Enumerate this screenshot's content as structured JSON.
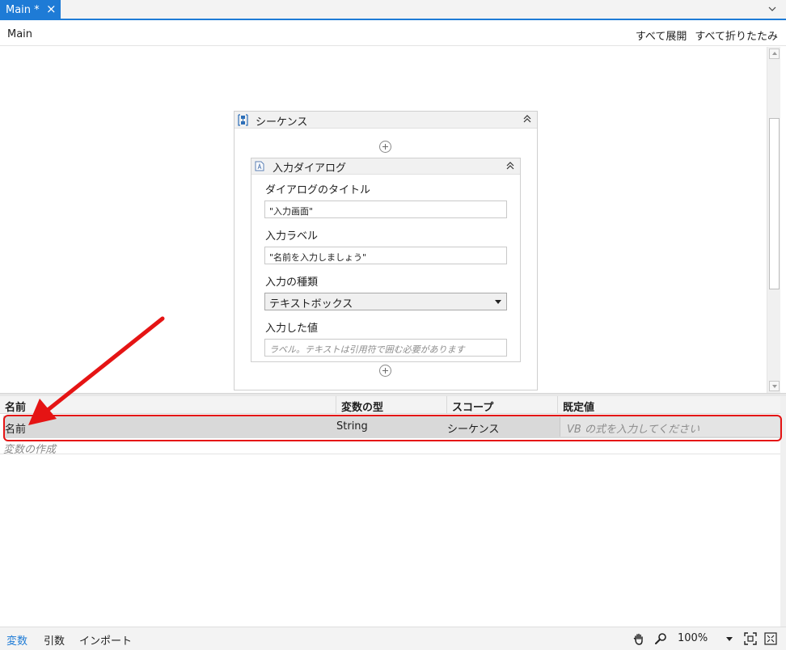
{
  "tabs": [
    {
      "label": "Main *"
    }
  ],
  "breadcrumb": "Main",
  "breadcrumb_actions": {
    "expand_all": "すべて展開",
    "collapse_all": "すべて折りたたみ"
  },
  "sequence": {
    "title": "シーケンス",
    "activity": {
      "title": "入力ダイアログ",
      "fields": {
        "dialog_title_label": "ダイアログのタイトル",
        "dialog_title_value": "\"入力画面\"",
        "input_label_label": "入力ラベル",
        "input_label_value": "\"名前を入力しましょう\"",
        "input_type_label": "入力の種類",
        "input_type_value": "テキストボックス",
        "result_label": "入力した値",
        "result_placeholder": "ラベル。テキストは引用符で囲む必要があります"
      }
    }
  },
  "variables": {
    "columns": {
      "name": "名前",
      "type": "変数の型",
      "scope": "スコープ",
      "default": "既定値"
    },
    "rows": [
      {
        "name": "名前",
        "type": "String",
        "scope": "シーケンス",
        "default_placeholder": "VB の式を入力してください"
      }
    ],
    "create_label": "変数の作成"
  },
  "bottom_tabs": {
    "variables": "変数",
    "arguments": "引数",
    "imports": "インポート"
  },
  "zoom": "100%",
  "colors": {
    "accent": "#1e7bd6",
    "highlight": "#e51414"
  },
  "icons": [
    "close-icon",
    "chevron-down-icon",
    "sequence-icon",
    "collapse-icon",
    "add-icon",
    "input-dialog-icon",
    "hand-icon",
    "search-icon",
    "fit-to-screen-icon",
    "overview-icon"
  ]
}
